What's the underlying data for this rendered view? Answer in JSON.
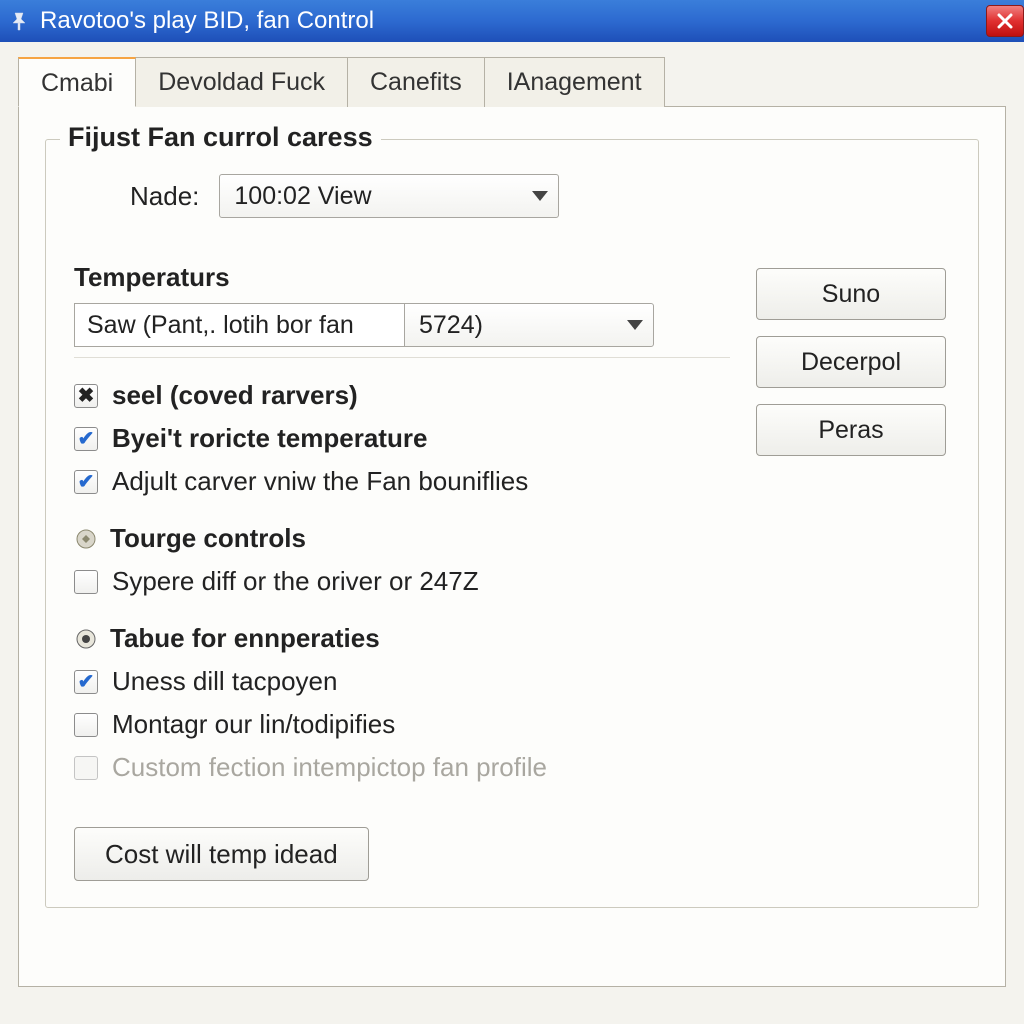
{
  "window": {
    "title": "Ravotoo's play BID, fan Control"
  },
  "tabs": [
    {
      "label": "Cmabi",
      "active": true
    },
    {
      "label": "Devoldad Fuck",
      "active": false
    },
    {
      "label": "Canefits",
      "active": false
    },
    {
      "label": "IAnagement",
      "active": false
    }
  ],
  "fieldset": {
    "legend": "Fijust Fan currol caress"
  },
  "nade": {
    "label": "Nade:",
    "value": "100:02 View"
  },
  "temperatures": {
    "heading": "Temperaturs",
    "text_value": "Saw (Pant,. lotih bor fan",
    "select_value": "5724)"
  },
  "side_buttons": {
    "suno": "Suno",
    "decerpol": "Decerpol",
    "peras": "Peras"
  },
  "section1": {
    "title": "seel (coved rarvers)",
    "chk1": "Byei't roricte temperature",
    "chk2": "Adjult carver vniw the Fan bouniflies"
  },
  "section2": {
    "title": "Tourge controls",
    "chk1": "Sypere diff or the oriver or 247Z"
  },
  "section3": {
    "title": "Tabue for ennperaties",
    "chk1": "Uness dill tacpoyen",
    "chk2": "Montagr our lin/todipifies",
    "chk3": "Custom fection intempictop fan profile"
  },
  "bottom_button": "Cost will temp idead"
}
